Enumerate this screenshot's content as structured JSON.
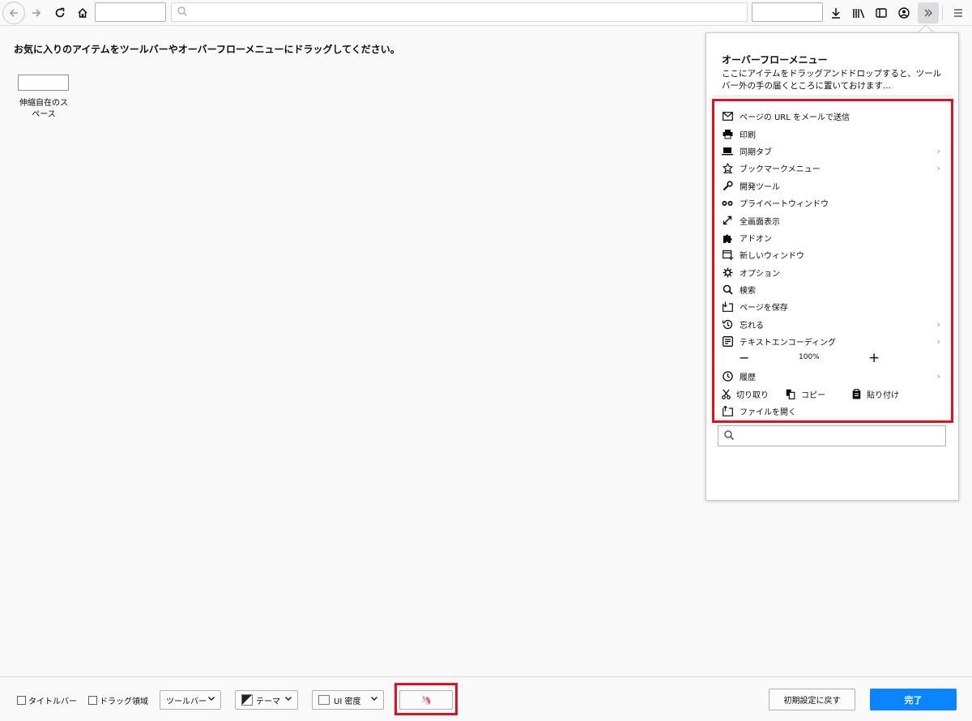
{
  "palette": {
    "hint": "お気に入りのアイテムをツールバーやオーバーフローメニューにドラッグしてください。",
    "flexible_space_label": "伸縮自在のスペース"
  },
  "overflow_panel": {
    "title": "オーバーフローメニュー",
    "description": "ここにアイテムをドラッグアンドドロップすると、ツールバー外の手の届くところに置いておけます...",
    "items": [
      {
        "label": "ページの URL をメールで送信",
        "icon": "mail-icon"
      },
      {
        "label": "印刷",
        "icon": "print-icon"
      },
      {
        "label": "同期タブ",
        "icon": "synced-tabs-icon"
      },
      {
        "label": "ブックマークメニュー",
        "icon": "bookmark-star-icon"
      },
      {
        "label": "開発ツール",
        "icon": "wrench-icon"
      },
      {
        "label": "プライベートウィンドウ",
        "icon": "private-mask-icon"
      },
      {
        "label": "全画面表示",
        "icon": "fullscreen-icon"
      },
      {
        "label": "アドオン",
        "icon": "puzzle-icon"
      },
      {
        "label": "新しいウィンドウ",
        "icon": "new-window-icon"
      },
      {
        "label": "オプション",
        "icon": "gear-icon"
      },
      {
        "label": "検索",
        "icon": "search-icon"
      },
      {
        "label": "ページを保存",
        "icon": "save-page-icon"
      },
      {
        "label": "忘れる",
        "icon": "forget-icon"
      },
      {
        "label": "テキストエンコーディング",
        "icon": "text-encoding-icon"
      }
    ],
    "zoom": {
      "minus": "−",
      "value": "100%",
      "plus": "+"
    },
    "history_label": "履歴",
    "edit": {
      "cut": "切り取り",
      "copy": "コピー",
      "paste": "貼り付け"
    },
    "open_file_label": "ファイルを開く"
  },
  "bottom_bar": {
    "title_bar_label": "タイトルバー",
    "drag_space_label": "ドラッグ領域",
    "toolbars_label": "ツールバー",
    "themes_label": "テーマ",
    "density_label": "UI 密度",
    "reset_label": "初期設定に戻す",
    "done_label": "完了"
  },
  "colors": {
    "accent": "#0a84ff",
    "highlight": "#e0101e"
  }
}
